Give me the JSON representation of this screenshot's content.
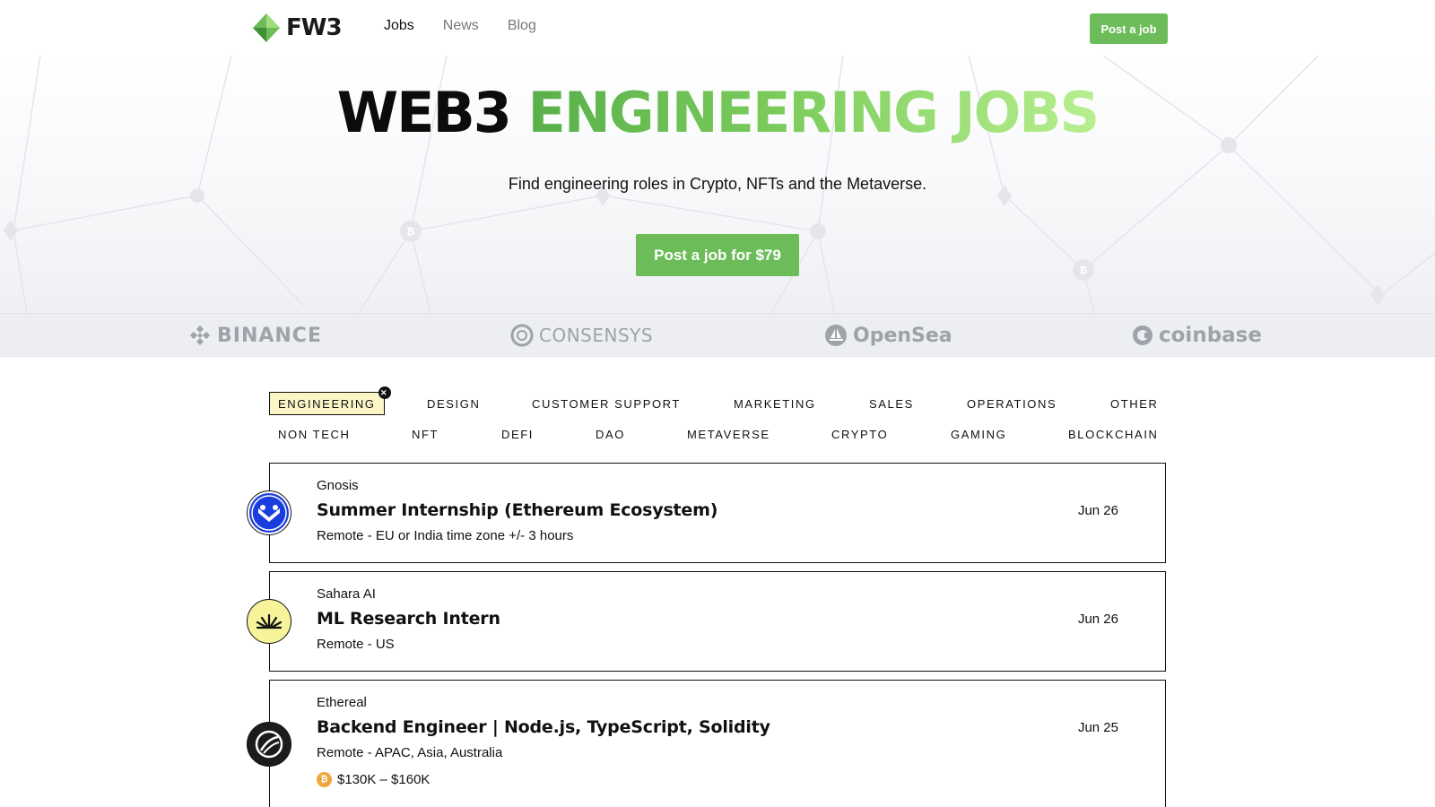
{
  "header": {
    "logo_text": "FW3",
    "nav": [
      {
        "label": "Jobs",
        "active": true
      },
      {
        "label": "News",
        "active": false
      },
      {
        "label": "Blog",
        "active": false
      }
    ],
    "post_job_label": "Post a job"
  },
  "hero": {
    "title_black": "WEB3",
    "title_green": "ENGINEERING JOBS",
    "subtitle": "Find engineering roles in Crypto, NFTs and the Metaverse.",
    "cta_label": "Post a job for $79"
  },
  "brands": [
    {
      "name": "BINANCE",
      "icon": "binance-icon"
    },
    {
      "name": "CONSENSYS",
      "icon": "consensys-icon"
    },
    {
      "name": "OpenSea",
      "icon": "opensea-icon"
    },
    {
      "name": "coinbase",
      "icon": "coinbase-icon"
    }
  ],
  "categories": {
    "row1": [
      "ENGINEERING",
      "DESIGN",
      "CUSTOMER SUPPORT",
      "MARKETING",
      "SALES",
      "OPERATIONS",
      "OTHER"
    ],
    "row2": [
      "NON TECH",
      "NFT",
      "DEFI",
      "DAO",
      "METAVERSE",
      "CRYPTO",
      "GAMING",
      "BLOCKCHAIN"
    ],
    "active": "ENGINEERING",
    "clear_icon": "close-icon"
  },
  "jobs": [
    {
      "company": "Gnosis",
      "title": "Summer Internship (Ethereum Ecosystem)",
      "location": "Remote - EU or India time zone +/- 3 hours",
      "date": "Jun 26",
      "logo_icon": "gnosis-owl-icon",
      "logo_color": "#1a3de0"
    },
    {
      "company": "Sahara AI",
      "title": "ML Research Intern",
      "location": "Remote - US",
      "date": "Jun 26",
      "logo_icon": "sahara-sun-icon",
      "logo_color": "#f6f39a"
    },
    {
      "company": "Ethereal",
      "title": "Backend Engineer | Node.js, TypeScript, Solidity",
      "location": "Remote - APAC, Asia, Australia",
      "date": "Jun 25",
      "salary": "$130K – $160K",
      "salary_icon": "bitcoin-coin-icon",
      "logo_icon": "ethereal-leaf-icon",
      "logo_color": "#1c1c1c"
    }
  ],
  "colors": {
    "accent_green": "#6cbd5a",
    "active_chip_bg": "#fcf6c6",
    "brand_gray": "#9ea2a9"
  }
}
